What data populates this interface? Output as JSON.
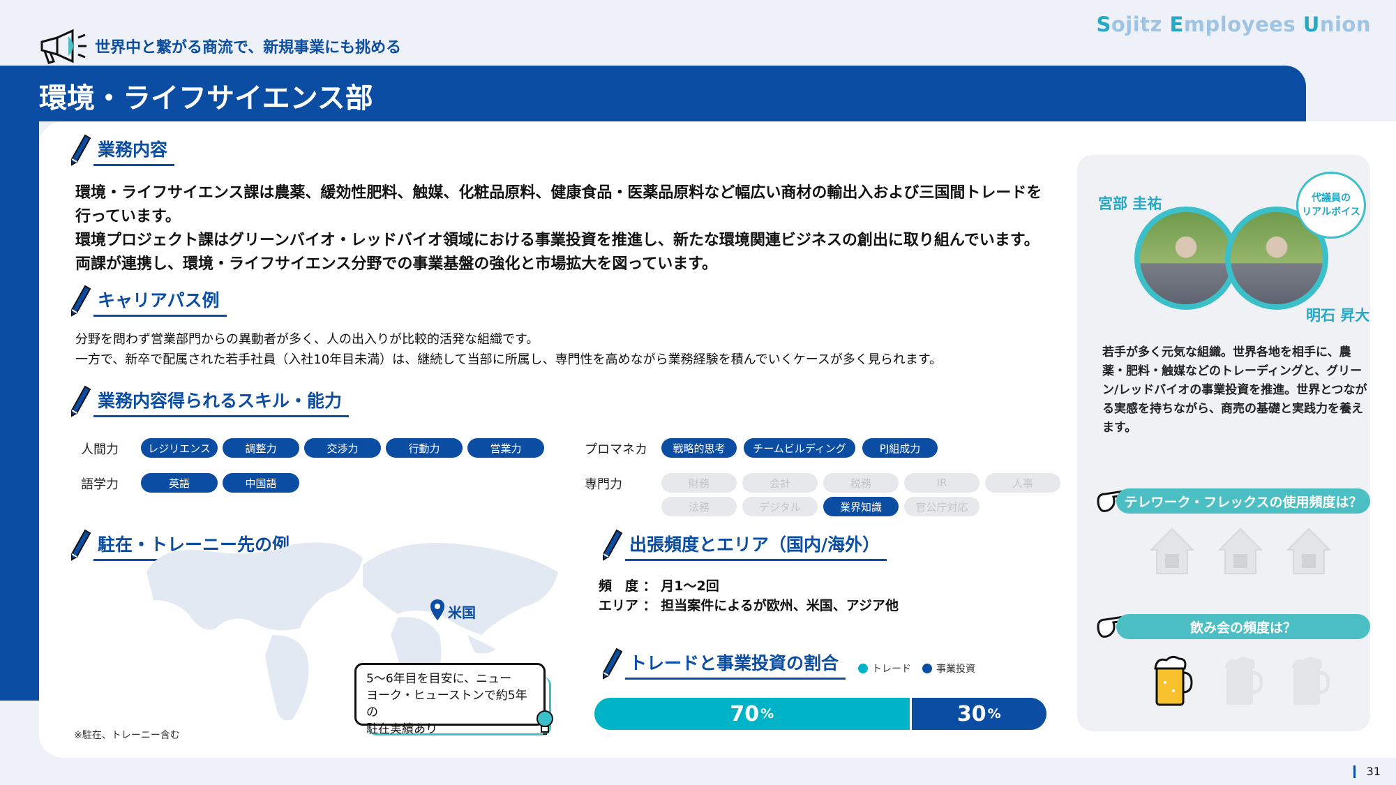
{
  "brand": {
    "cap1": "S",
    "rest1": "ojitz ",
    "cap2": "E",
    "rest2": "mployees ",
    "cap3": "U",
    "rest3": "nion"
  },
  "header": {
    "tagline": "世界中と繋がる商流で、新規事業にも挑める",
    "title": "環境・ライフサイエンス部"
  },
  "business": {
    "heading": "業務内容",
    "lines": [
      "環境・ライフサイエンス課は農薬、緩効性肥料、触媒、化粧品原料、健康食品・医薬品原料など幅広い商材の輸出入および三国間トレードを",
      "行っています。",
      "環境プロジェクト課はグリーンバイオ・レッドバイオ領域における事業投資を推進し、新たな環境関連ビジネスの創出に取り組んでいます。",
      "両課が連携し、環境・ライフサイエンス分野での事業基盤の強化と市場拡大を図っています。"
    ]
  },
  "career": {
    "heading": "キャリアパス例",
    "lines": [
      "分野を問わず営業部門からの異動者が多く、人の出入りが比較的活発な組織です。",
      "一方で、新卒で配属された若手社員（入社10年目未満）は、継続して当部に所属し、専門性を高めながら業務経験を積んでいくケースが多く見られます。"
    ]
  },
  "skills": {
    "heading": "業務内容得られるスキル・能力",
    "human": {
      "label": "人間力",
      "chips": [
        "レジリエンス",
        "調整力",
        "交渉力",
        "行動力",
        "営業力"
      ]
    },
    "lang": {
      "label": "語学力",
      "chips": [
        "英語",
        "中国語"
      ]
    },
    "promane": {
      "label": "プロマネカ",
      "chips": [
        "戦略的思考",
        "チームビルディング",
        "PJ組成力"
      ]
    },
    "expert": {
      "label": "専門力",
      "chips": [
        "財務",
        "会計",
        "税務",
        "IR",
        "人事",
        "法務",
        "デジタル",
        "業界知識",
        "官公庁対応"
      ],
      "active": [
        false,
        false,
        false,
        false,
        false,
        false,
        false,
        true,
        false
      ]
    }
  },
  "station": {
    "heading": "駐在・トレーニー先の例",
    "pin": "米国",
    "callout": [
      "5～6年目を目安に、ニュー",
      "ヨーク・ヒューストンで約5年の",
      "駐在実績あり"
    ],
    "note": "※駐在、トレーニー含む"
  },
  "travel": {
    "heading": "出張頻度とエリア（国内/海外）",
    "freq_label": "頻　度",
    "freq_value": "月1～2回",
    "area_label": "エリア",
    "area_value": "担当案件によるが欧州、米国、アジア他",
    "sep": "："
  },
  "ratio": {
    "heading": "トレードと事業投資の割合",
    "legend": [
      "トレード",
      "事業投資"
    ],
    "colors": [
      "#00b3c6",
      "#0a4da2"
    ],
    "values": [
      70,
      30
    ],
    "unit": "%"
  },
  "voices": {
    "name1": "宮部 圭祐",
    "name2": "明石 昇大",
    "bubble": [
      "代議員の",
      "リアルボイス"
    ],
    "text": "若手が多く元気な組織。世界各地を相手に、農薬・肥料・触媒などのトレーディングと、グリーン/レッドバイオの事業投資を推進。世界とつながる実感を持ちながら、商売の基礎と実践力を養えます。"
  },
  "telework": {
    "question": "テレワーク・フレックスの使用頻度は？",
    "level": 0,
    "max": 3
  },
  "drinking": {
    "question": "飲み会の頻度は？",
    "level": 1,
    "max": 3
  },
  "page": {
    "number": "31"
  }
}
